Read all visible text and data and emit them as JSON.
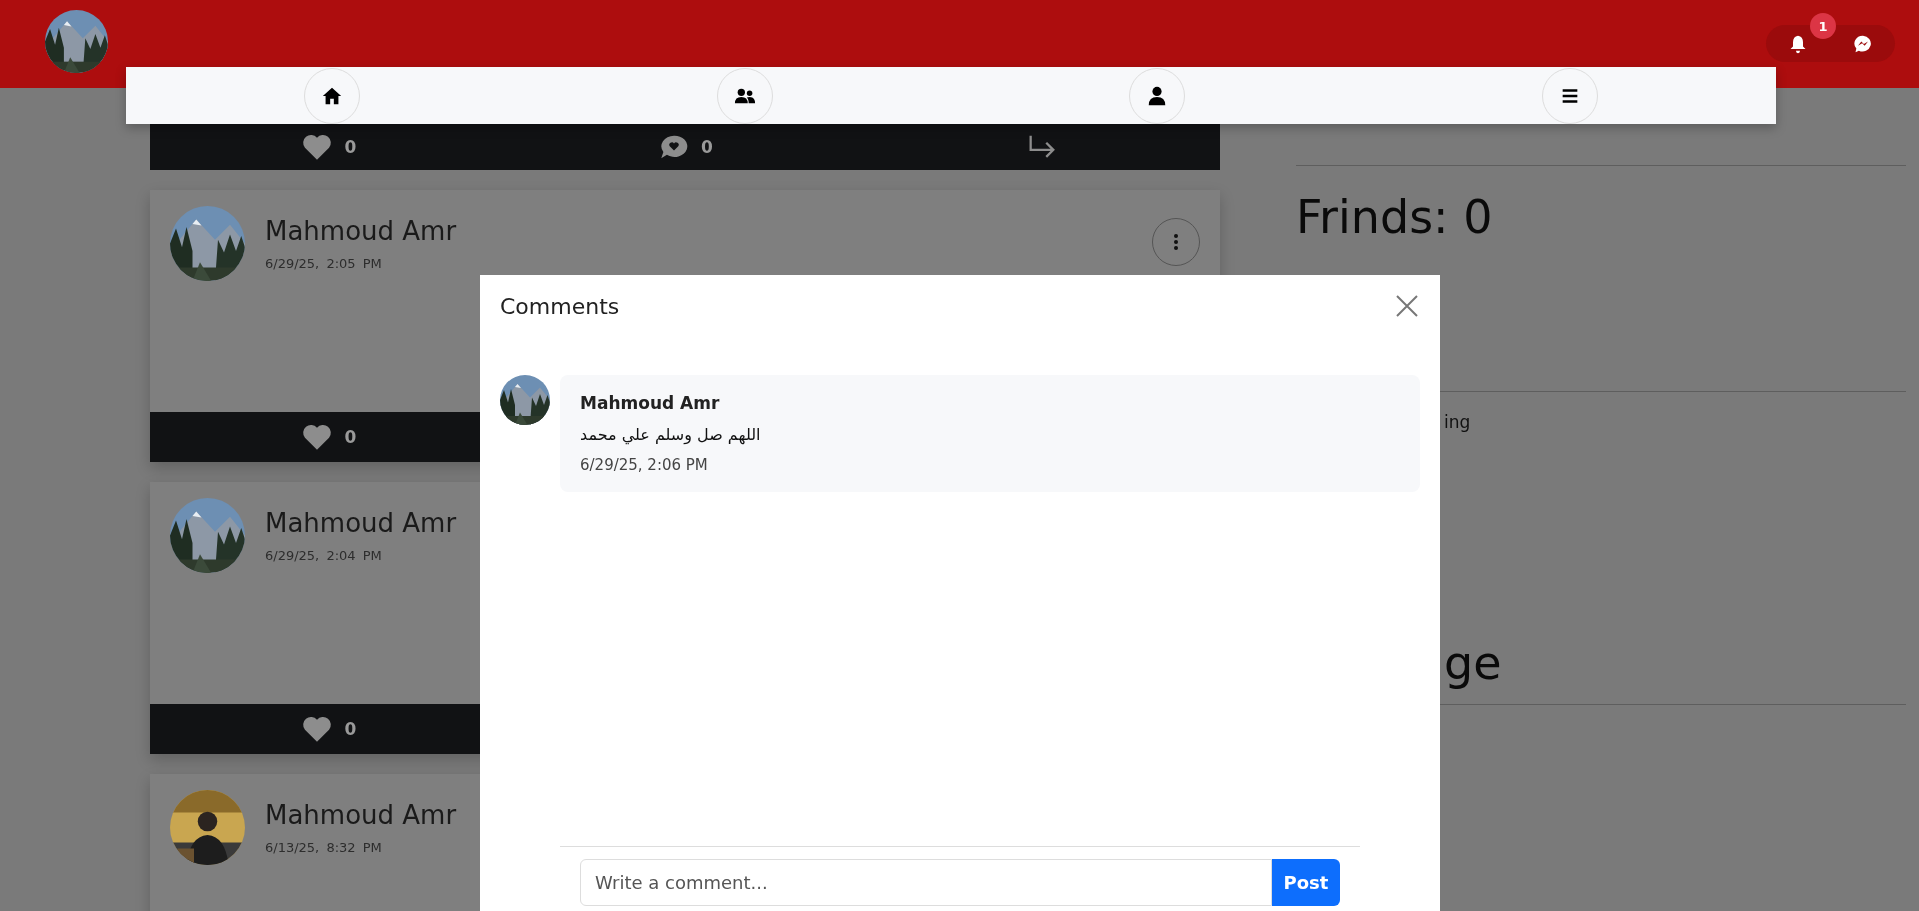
{
  "header": {
    "notification_badge": "1"
  },
  "nav": {
    "tabs": [
      {
        "kind": "home"
      },
      {
        "kind": "friends"
      },
      {
        "kind": "profile"
      },
      {
        "kind": "menu"
      }
    ]
  },
  "feed": {
    "top_post_actions": {
      "likes": "0",
      "comments": "0"
    },
    "posts": [
      {
        "author": "Mahmoud Amr",
        "time": "6/29/25, 2:05 PM",
        "has_menu": true,
        "likes": "0"
      },
      {
        "author": "Mahmoud Amr",
        "time": "6/29/25, 2:04 PM",
        "has_menu": false,
        "likes": "0"
      },
      {
        "author": "Mahmoud Amr",
        "time": "6/13/25, 8:32 PM",
        "has_menu": false
      }
    ]
  },
  "sidebar": {
    "friends": "Frinds: 0",
    "partial_text": "ing",
    "partial_heading": "ge"
  },
  "modal": {
    "title": "Comments",
    "comments": [
      {
        "author": "Mahmoud Amr",
        "text": "اللهم صل وسلم علي محمد",
        "time": "6/29/25, 2:06 PM"
      }
    ],
    "input": {
      "placeholder": "Write a comment..."
    },
    "submit": "Post"
  }
}
